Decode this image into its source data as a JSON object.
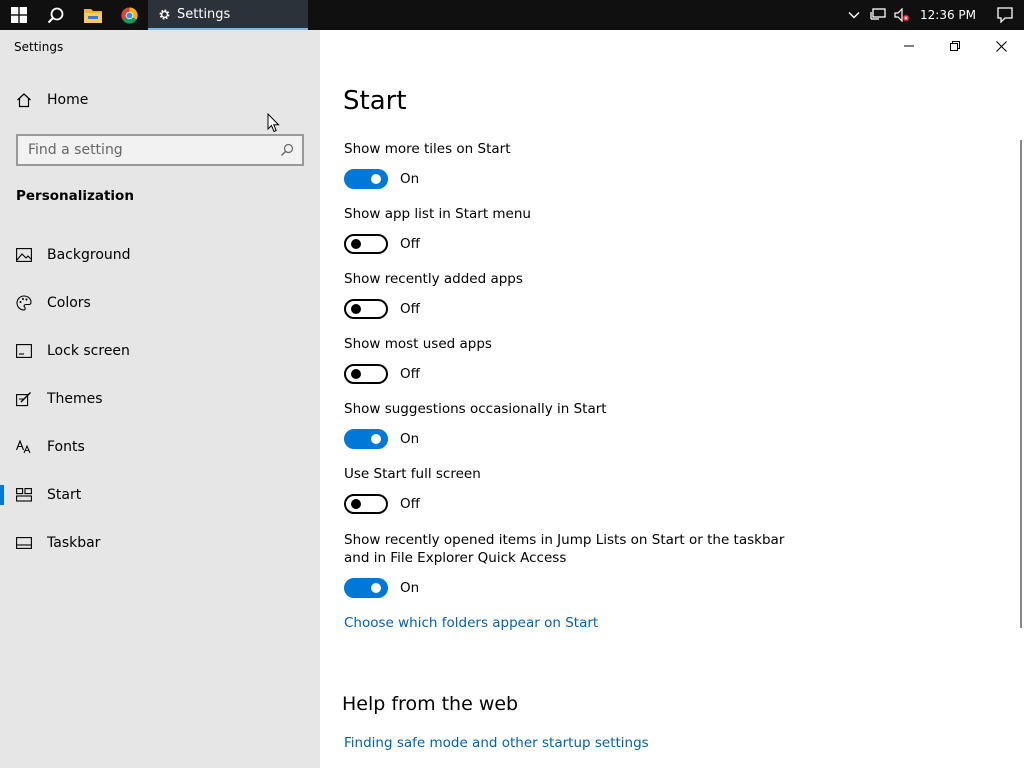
{
  "taskbar": {
    "start_icon": "windows-logo-icon",
    "search_icon": "search-icon",
    "explorer_icon": "folder-icon",
    "chrome_icon": "chrome-icon",
    "active_app": "Settings",
    "clock": "12:36 PM",
    "accent": "#76b9ed"
  },
  "window": {
    "app_title": "Settings"
  },
  "sidebar": {
    "home_label": "Home",
    "search_placeholder": "Find a setting",
    "section_title": "Personalization",
    "items": [
      {
        "label": "Background",
        "icon": "picture-icon"
      },
      {
        "label": "Colors",
        "icon": "palette-icon"
      },
      {
        "label": "Lock screen",
        "icon": "lock-screen-icon"
      },
      {
        "label": "Themes",
        "icon": "themes-icon"
      },
      {
        "label": "Fonts",
        "icon": "fonts-icon"
      },
      {
        "label": "Start",
        "icon": "start-icon",
        "selected": true
      },
      {
        "label": "Taskbar",
        "icon": "taskbar-icon"
      }
    ],
    "selected_color": "#0078d7"
  },
  "main": {
    "title": "Start",
    "settings": [
      {
        "label": "Show more tiles on Start",
        "state": "On"
      },
      {
        "label": "Show app list in Start menu",
        "state": "Off"
      },
      {
        "label": "Show recently added apps",
        "state": "Off"
      },
      {
        "label": "Show most used apps",
        "state": "Off"
      },
      {
        "label": "Show suggestions occasionally in Start",
        "state": "On"
      },
      {
        "label": "Use Start full screen",
        "state": "Off"
      },
      {
        "label": "Show recently opened items in Jump Lists on Start or the taskbar and in File Explorer Quick Access",
        "state": "On"
      }
    ],
    "folders_link": "Choose which folders appear on Start",
    "help_title": "Help from the web",
    "help_links": [
      "Finding safe mode and other startup settings"
    ],
    "toggle_on_color": "#0078d7",
    "link_color": "#0063b1"
  }
}
